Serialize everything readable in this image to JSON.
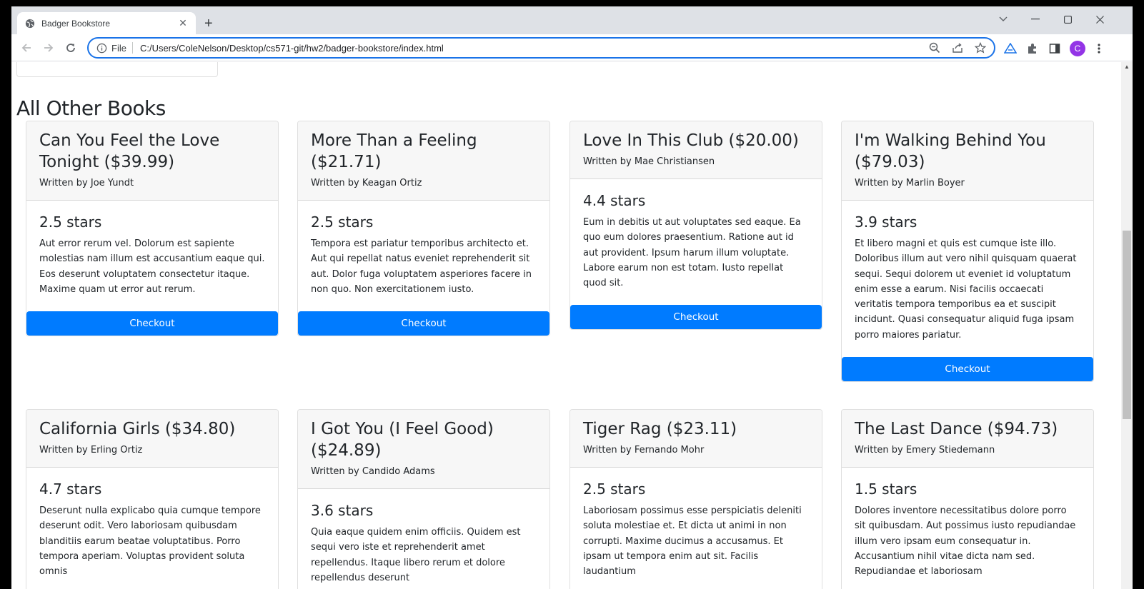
{
  "browser": {
    "tab_title": "Badger Bookstore",
    "scheme_label": "File",
    "url": "C:/Users/ColeNelson/Desktop/cs571-git/hw2/badger-bookstore/index.html",
    "profile_initial": "C",
    "accent": "#1a73e8"
  },
  "page": {
    "section_title": "All Other Books",
    "checkout_label": "Checkout",
    "button_color": "#007bff",
    "books": [
      {
        "title": "Can You Feel the Love Tonight ($39.99)",
        "author": "Written by Joe Yundt",
        "rating": "2.5 stars",
        "description": "Aut error rerum vel. Dolorum est sapiente molestias nam illum est accusantium eaque qui. Eos deserunt voluptatem consectetur itaque. Maxime quam ut error aut rerum."
      },
      {
        "title": "More Than a Feeling ($21.71)",
        "author": "Written by Keagan Ortiz",
        "rating": "2.5 stars",
        "description": "Tempora est pariatur temporibus architecto et. Aut qui repellat natus eveniet reprehenderit sit aut. Dolor fuga voluptatem asperiores facere in non quo. Non exercitationem iusto."
      },
      {
        "title": "Love In This Club ($20.00)",
        "author": "Written by Mae Christiansen",
        "rating": "4.4 stars",
        "description": "Eum in debitis ut aut voluptates sed eaque. Ea quo eum dolores praesentium. Ratione aut id aut provident. Ipsum harum illum voluptate. Labore earum non est totam. Iusto repellat quod sit."
      },
      {
        "title": "I'm Walking Behind You ($79.03)",
        "author": "Written by Marlin Boyer",
        "rating": "3.9 stars",
        "description": "Et libero magni et quis est cumque iste illo. Doloribus illum aut vero nihil quisquam quaerat sequi. Sequi dolorem ut eveniet id voluptatum enim esse a earum. Nisi facilis occaecati veritatis tempora temporibus ea et suscipit incidunt. Quasi consequatur aliquid fuga ipsam porro maiores pariatur."
      },
      {
        "title": "California Girls ($34.80)",
        "author": "Written by Erling Ortiz",
        "rating": "4.7 stars",
        "description": "Deserunt nulla explicabo quia cumque tempore deserunt odit. Vero laboriosam quibusdam blanditiis earum beatae voluptatibus. Porro tempora aperiam. Voluptas provident soluta omnis"
      },
      {
        "title": "I Got You (I Feel Good) ($24.89)",
        "author": "Written by Candido Adams",
        "rating": "3.6 stars",
        "description": "Quia eaque quidem enim officiis. Quidem est sequi vero iste et reprehenderit amet repellendus. Itaque libero rerum et dolore repellendus deserunt"
      },
      {
        "title": "Tiger Rag ($23.11)",
        "author": "Written by Fernando Mohr",
        "rating": "2.5 stars",
        "description": "Laboriosam possimus esse perspiciatis deleniti soluta molestiae et. Et dicta ut animi in non corrupti. Maxime ducimus a accusamus. Et ipsam ut tempora enim aut sit. Facilis laudantium"
      },
      {
        "title": "The Last Dance ($94.73)",
        "author": "Written by Emery Stiedemann",
        "rating": "1.5 stars",
        "description": "Dolores inventore necessitatibus dolore porro sit quibusdam. Aut possimus iusto repudiandae illum vero ipsam eum consequatur in. Accusantium nihil vitae dicta nam sed. Repudiandae et laboriosam"
      }
    ]
  }
}
